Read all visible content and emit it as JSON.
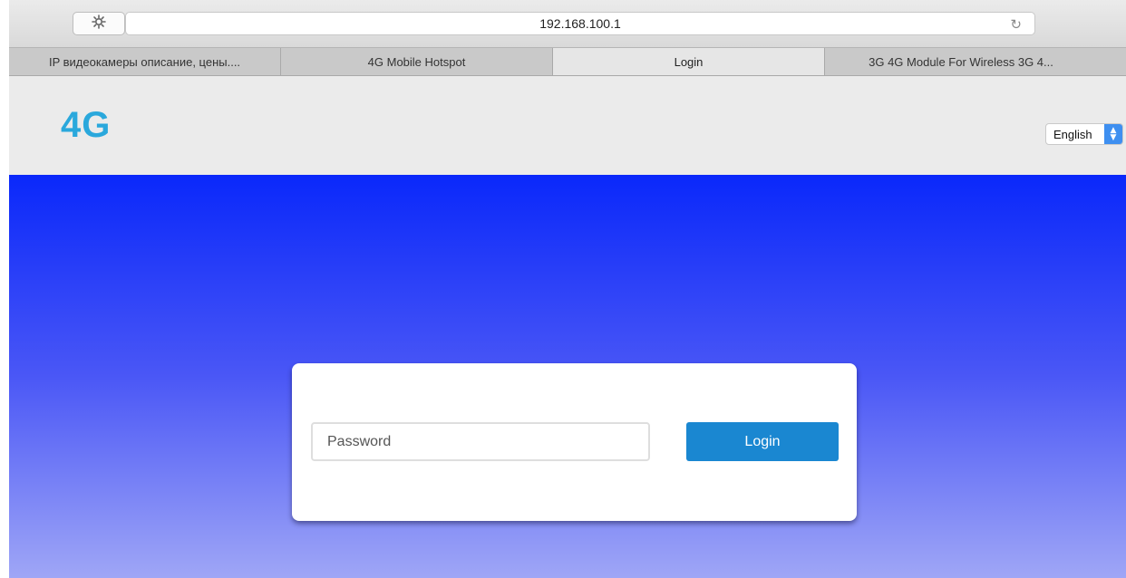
{
  "browser": {
    "address": "192.168.100.1",
    "extension_icon": "gear-bug-icon",
    "reload_icon": "reload-icon",
    "tabs": [
      {
        "label": "IP видеокамеры описание, цены...."
      },
      {
        "label": "4G Mobile Hotspot"
      },
      {
        "label": "Login",
        "active": true
      },
      {
        "label": "3G 4G Module For Wireless 3G 4..."
      }
    ]
  },
  "header": {
    "logo": "4G",
    "language_selected": "English"
  },
  "login": {
    "password_placeholder": "Password",
    "button_label": "Login"
  },
  "colors": {
    "logo": "#2aa8dc",
    "hero_top": "#0a28fa",
    "hero_bottom": "#9fa6f6",
    "login_button": "#1a87d1",
    "select_accent": "#3e8ff0"
  }
}
